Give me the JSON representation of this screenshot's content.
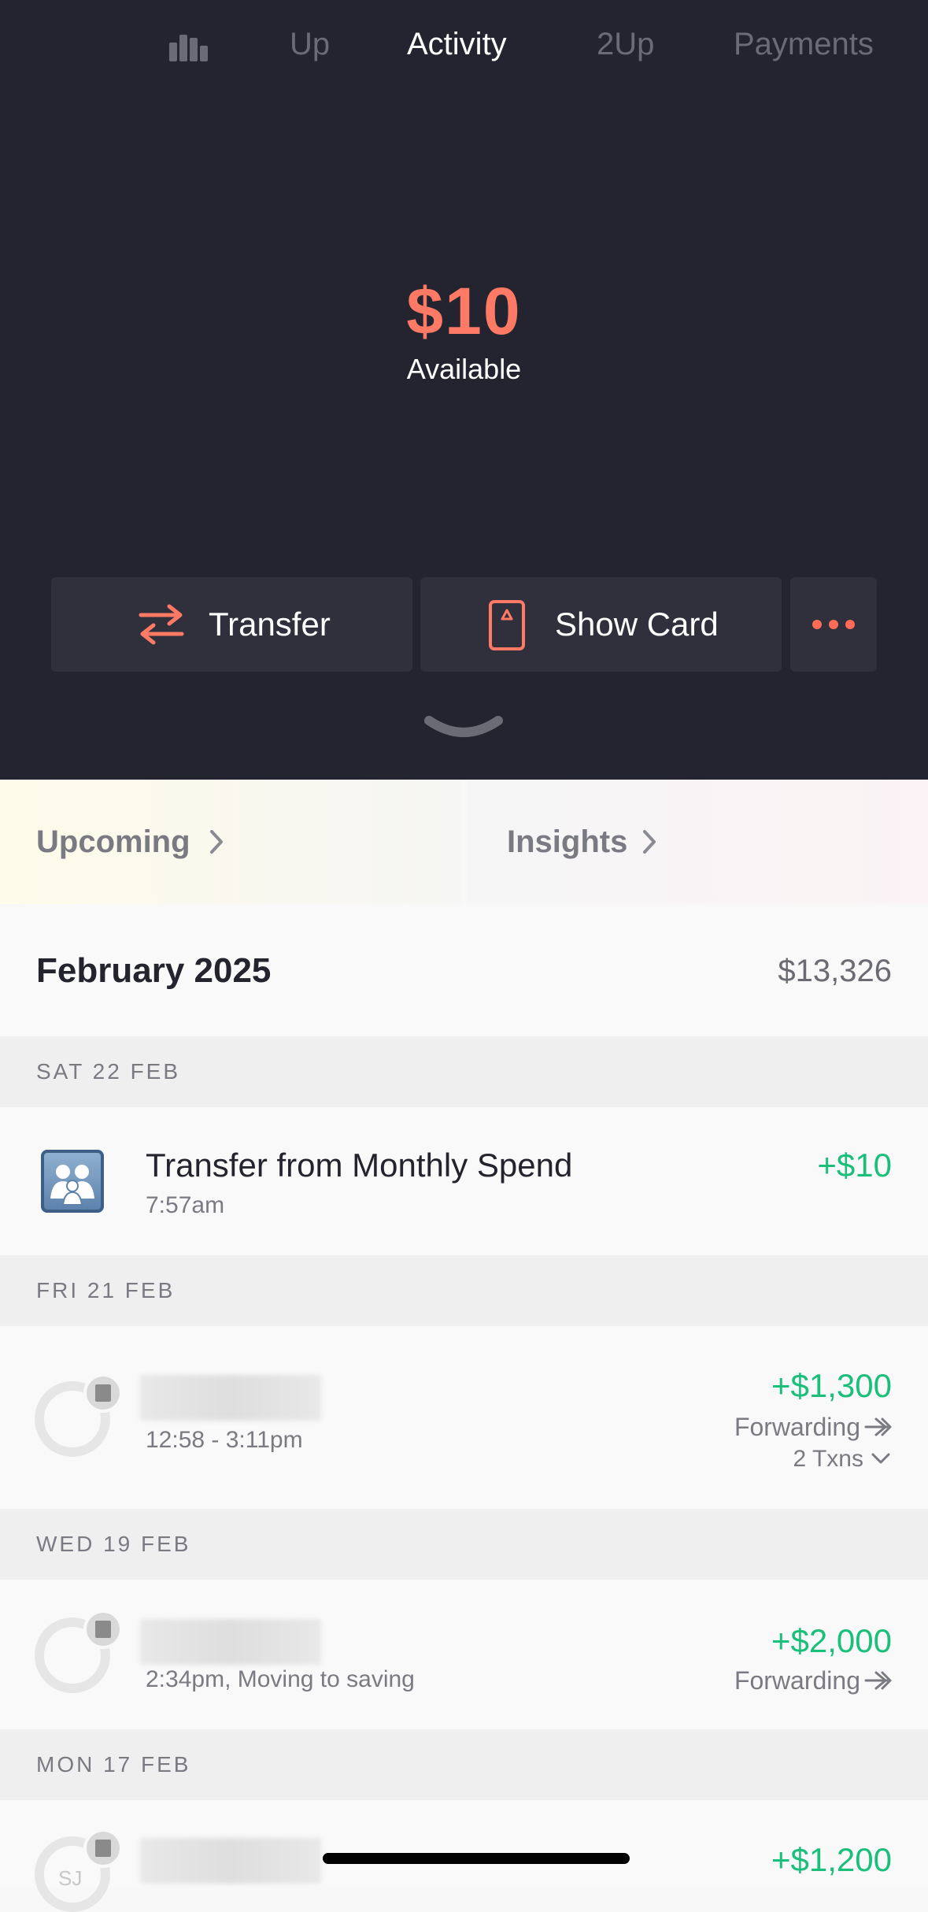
{
  "nav": {
    "tabs": [
      "Up",
      "Activity",
      "2Up",
      "Payments"
    ],
    "active": "Activity"
  },
  "balance": {
    "amount": "$10",
    "label": "Available"
  },
  "actions": {
    "transfer": "Transfer",
    "show_card": "Show Card"
  },
  "cards": {
    "upcoming": "Upcoming",
    "insights": "Insights"
  },
  "month": {
    "label": "February 2025",
    "total": "$13,326"
  },
  "days": [
    {
      "label": "SAT 22 FEB",
      "tx": {
        "title": "Transfer from Monthly Spend",
        "time": "7:57am",
        "amount": "+$10"
      }
    },
    {
      "label": "FRI 21 FEB",
      "tx": {
        "time": "12:58 - 3:11pm",
        "amount": "+$1,300",
        "status": "Forwarding",
        "count": "2 Txns"
      }
    },
    {
      "label": "WED 19 FEB",
      "tx": {
        "time": "2:34pm, Moving to saving",
        "amount": "+$2,000",
        "status": "Forwarding"
      }
    },
    {
      "label": "MON 17 FEB",
      "tx": {
        "initials": "SJ",
        "amount": "+$1,200"
      }
    }
  ],
  "colors": {
    "accent": "#ff7a64",
    "positive": "#1bbf7c",
    "dark_bg": "#242430"
  }
}
